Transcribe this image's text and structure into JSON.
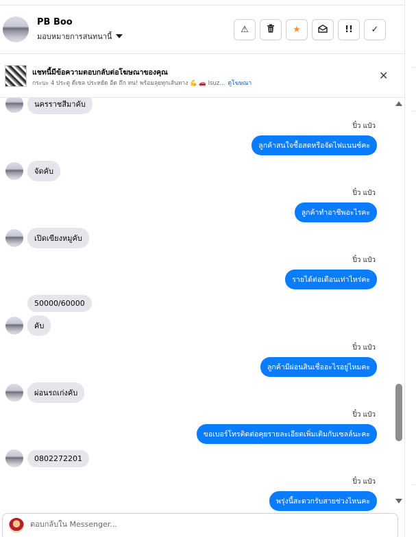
{
  "header": {
    "name": "PB Boo",
    "assign_label": "มอบหมายการสนทนานี้",
    "buttons": [
      {
        "icon": "warning-icon",
        "glyph": "⚠"
      },
      {
        "icon": "trash-icon",
        "glyph": "🗑"
      },
      {
        "icon": "star-icon",
        "glyph": "★",
        "color": "#f7923b"
      },
      {
        "icon": "mark-unread-icon",
        "glyph": "✉"
      },
      {
        "icon": "follow-up-icon",
        "glyph": "!!"
      },
      {
        "icon": "check-icon",
        "glyph": "✓"
      }
    ]
  },
  "banner": {
    "title": "แชทนี้มีข้อความตอบกลับต่อโฆษณาของคุณ",
    "description": "กระบะ 4 ประตู ดีเซล ประหยัด อีด ถึก ทน! พร้อมลุยทุกเส้นทาง 💪 🚗 Isuz...",
    "link": "ดูโฆษณา"
  },
  "messages": [
    {
      "dir": "in",
      "text": "นครราชสีมาคับ",
      "avatar": true
    },
    {
      "dir": "out",
      "sender": "ปิ๋ว แป๋ว",
      "text": "ลูกค้าสนใจซื้อสดหรือจัดไฟแนนซ์คะ"
    },
    {
      "dir": "in",
      "text": "จัดคับ",
      "avatar": true
    },
    {
      "dir": "out",
      "sender": "ปิ๋ว แป๋ว",
      "text": "ลูกค้าทำอาชีพอะไรคะ"
    },
    {
      "dir": "in",
      "text": "เปิดเขียงหมูคับ",
      "avatar": true
    },
    {
      "dir": "out",
      "sender": "ปิ๋ว แป๋ว",
      "text": "รายได้ต่อเดือนเท่าไหร่คะ"
    },
    {
      "dir": "in",
      "text": "50000/60000",
      "avatar": false
    },
    {
      "dir": "in",
      "text": "คับ",
      "avatar": true
    },
    {
      "dir": "out",
      "sender": "ปิ๋ว แป๋ว",
      "text": "ลูกค้ามีผ่อนสินเชื่ออะไรอยู่ไหมคะ"
    },
    {
      "dir": "in",
      "text": "ผ่อนรถเก่งคับ",
      "avatar": true
    },
    {
      "dir": "out",
      "sender": "ปิ๋ว แป๋ว",
      "text": "ขอเบอร์โทรติดต่อคุยรายละเอียดเพิ่มเติมกับเซลล์นะคะ"
    },
    {
      "dir": "in",
      "text": "0802272201",
      "avatar": true
    },
    {
      "dir": "out",
      "sender": "ปิ๋ว แป๋ว",
      "text": "พรุ่งนี้สะดวกรับสายช่วงไหนคะ"
    }
  ],
  "composer": {
    "placeholder": "ตอบกลับใน Messenger..."
  }
}
